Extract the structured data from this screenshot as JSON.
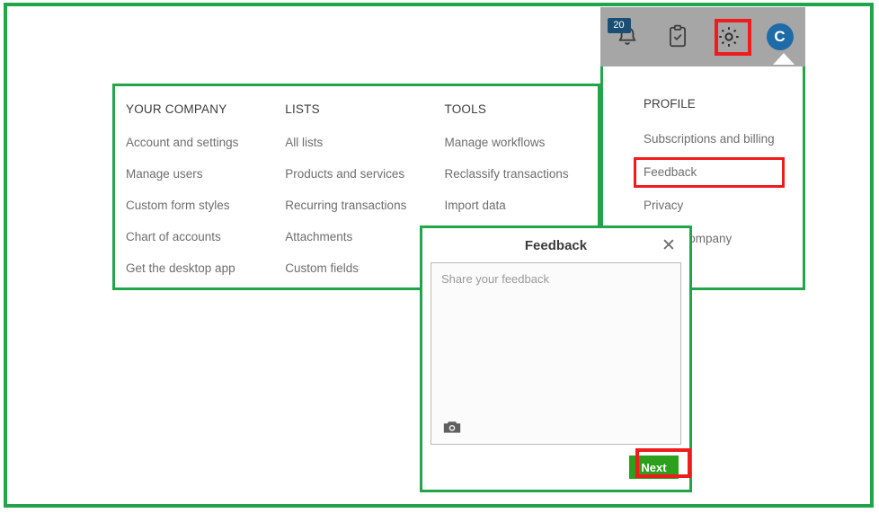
{
  "topbar": {
    "notifications": {
      "icon": "bell-icon",
      "badge_count": "20"
    },
    "tasks": {
      "icon": "clipboard-check-icon"
    },
    "settings": {
      "icon": "gear-icon"
    },
    "avatar": {
      "initial": "C"
    }
  },
  "mega_menu": {
    "columns": [
      {
        "heading": "YOUR COMPANY",
        "items": [
          "Account and settings",
          "Manage users",
          "Custom form styles",
          "Chart of accounts",
          "Get the desktop app"
        ]
      },
      {
        "heading": "LISTS",
        "items": [
          "All lists",
          "Products and services",
          "Recurring transactions",
          "Attachments",
          "Custom fields"
        ]
      },
      {
        "heading": "TOOLS",
        "items": [
          "Manage workflows",
          "Reclassify transactions",
          "Import data"
        ]
      }
    ]
  },
  "profile_menu": {
    "heading": "PROFILE",
    "items": [
      "Subscriptions and billing",
      "Feedback",
      "Privacy",
      "Switch company"
    ]
  },
  "feedback_modal": {
    "title": "Feedback",
    "close_label": "✕",
    "textarea_placeholder": "Share your feedback",
    "attachment_icon": "camera-icon",
    "next_label": "Next"
  },
  "annotations": {
    "highlight_color": "#ee1c1c",
    "frame_color": "#22a44a"
  }
}
